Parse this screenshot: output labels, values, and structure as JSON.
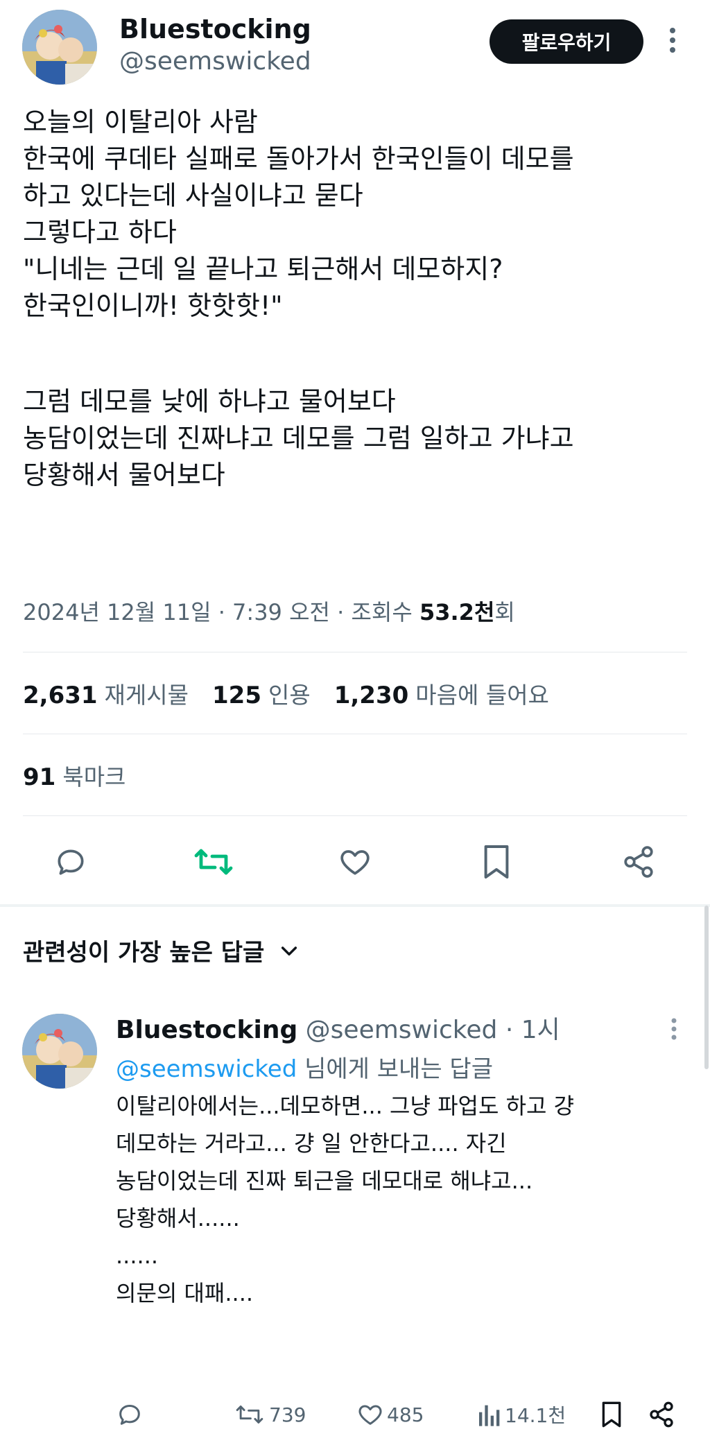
{
  "tweet": {
    "author_name": "Bluestocking",
    "author_handle": "@seemswicked",
    "follow_label": "팔로우하기",
    "lines": [
      "오늘의 이탈리아 사람",
      "한국에 쿠데타 실패로 돌아가서 한국인들이 데모를",
      "하고 있다는데 사실이냐고 묻다",
      "그렇다고 하다",
      "\"니네는 근데 일 끝나고 퇴근해서 데모하지?",
      "한국인이니까! 핫핫핫!\"",
      "",
      "그럼 데모를 낮에 하냐고 물어보다",
      "농담이었는데 진짜냐고 데모를 그럼 일하고 가냐고",
      "당황해서 물어보다"
    ],
    "timestamp": "2024년 12월 11일 · 7:39 오전 · 조회수 ",
    "views": "53.2천",
    "views_suffix": "회",
    "stats": {
      "retweets": "2,631",
      "retweets_label": "재게시물",
      "quotes": "125",
      "quotes_label": "인용",
      "likes": "1,230",
      "likes_label": "마음에 들어요",
      "bookmarks": "91",
      "bookmarks_label": "북마크"
    },
    "actions": {
      "reply_icon": "reply-icon",
      "retweet_icon": "retweet-icon",
      "like_icon": "heart-icon",
      "bookmark_icon": "bookmark-icon",
      "share_icon": "share-icon",
      "retweet_color": "#00ba7c"
    }
  },
  "replies_section": {
    "sort_label": "관련성이 가장 높은 답글"
  },
  "reply": {
    "author_name": "Bluestocking",
    "author_handle": "@seemswicked",
    "time": "· 1시",
    "replying_to_handle": "@seemswicked",
    "replying_to_suffix": " 님에게 보내는 답글",
    "lines": [
      "이탈리아에서는...데모하면... 그냥 파업도 하고 걍",
      "데모하는 거라고... 걍 일 안한다고.... 자긴",
      "농담이었는데 진짜 퇴근을 데모대로 해냐고...",
      "당황해서......",
      "",
      "......",
      "",
      "의문의 대패...."
    ],
    "retweets": "739",
    "likes": "485",
    "views": "14.1천"
  }
}
